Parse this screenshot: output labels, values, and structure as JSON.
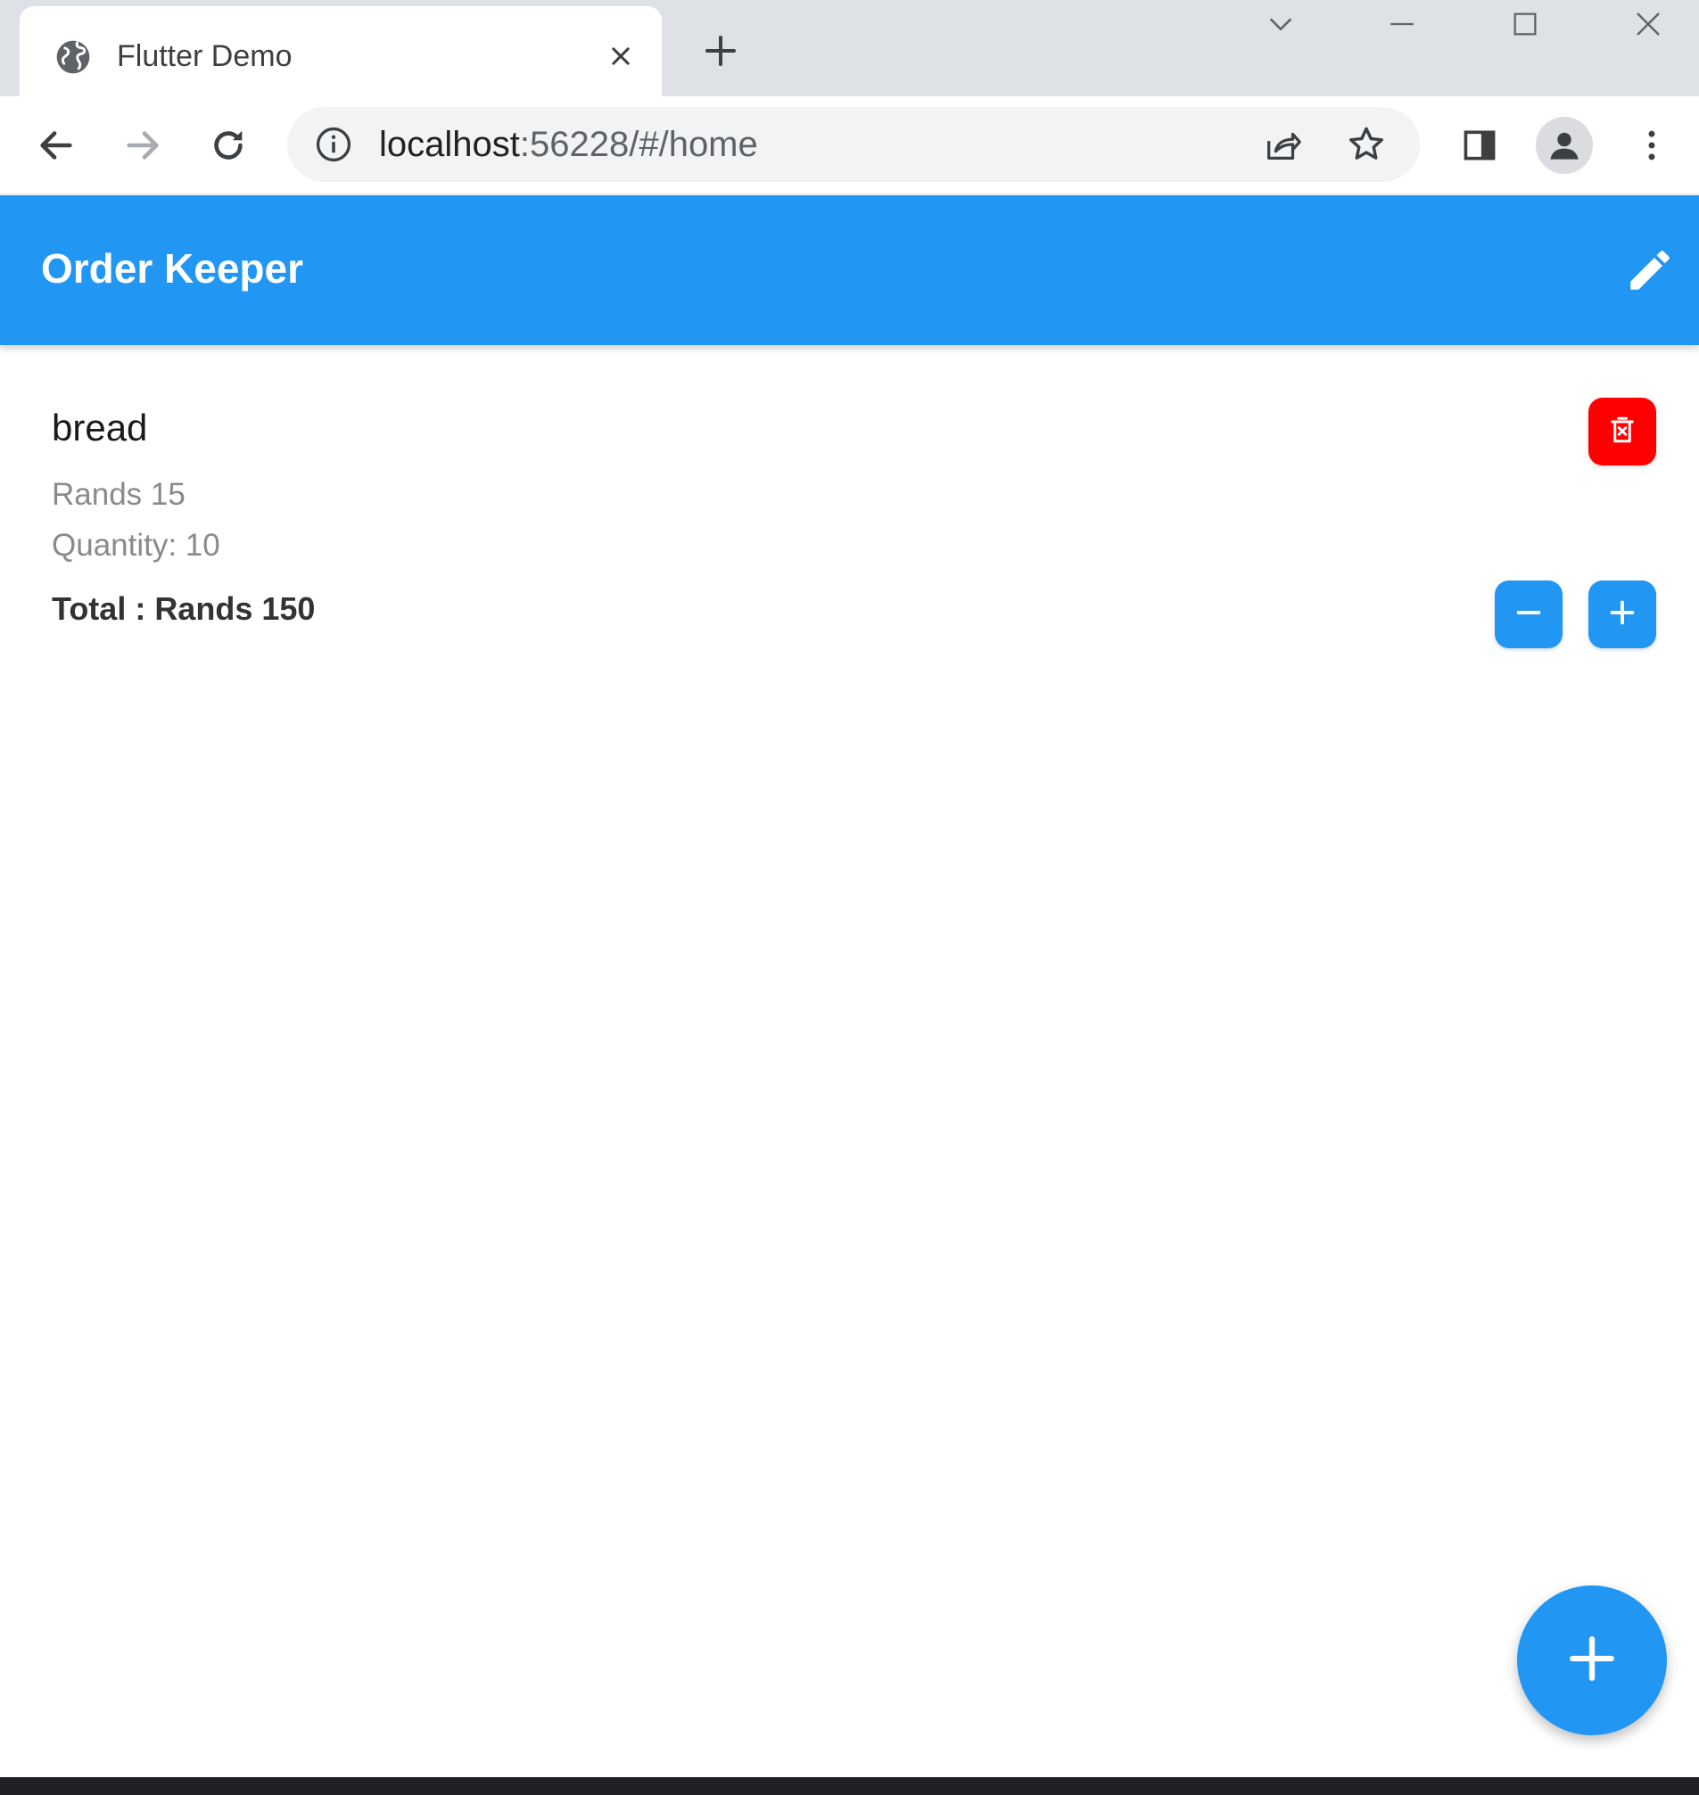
{
  "browser": {
    "tab": {
      "title": "Flutter Demo",
      "favicon": "globe-icon"
    },
    "address": {
      "host": "localhost",
      "path": ":56228/#/home"
    },
    "icons": {
      "back": "arrow-left-icon",
      "forward": "arrow-right-icon",
      "reload": "reload-icon",
      "info": "info-icon",
      "share": "share-icon",
      "bookmark": "star-icon",
      "side_panel": "side-panel-icon",
      "profile": "person-icon",
      "menu": "kebab-menu-icon"
    }
  },
  "app": {
    "title": "Order Keeper",
    "edit_icon": "pencil-icon",
    "primary_color": "#2196f3",
    "danger_color": "#ff0000"
  },
  "items": [
    {
      "name": "bread",
      "price": "Rands 15",
      "quantity": "Quantity: 10",
      "total": "Total : Rands 150"
    }
  ],
  "fab": {
    "icon": "plus-icon"
  }
}
